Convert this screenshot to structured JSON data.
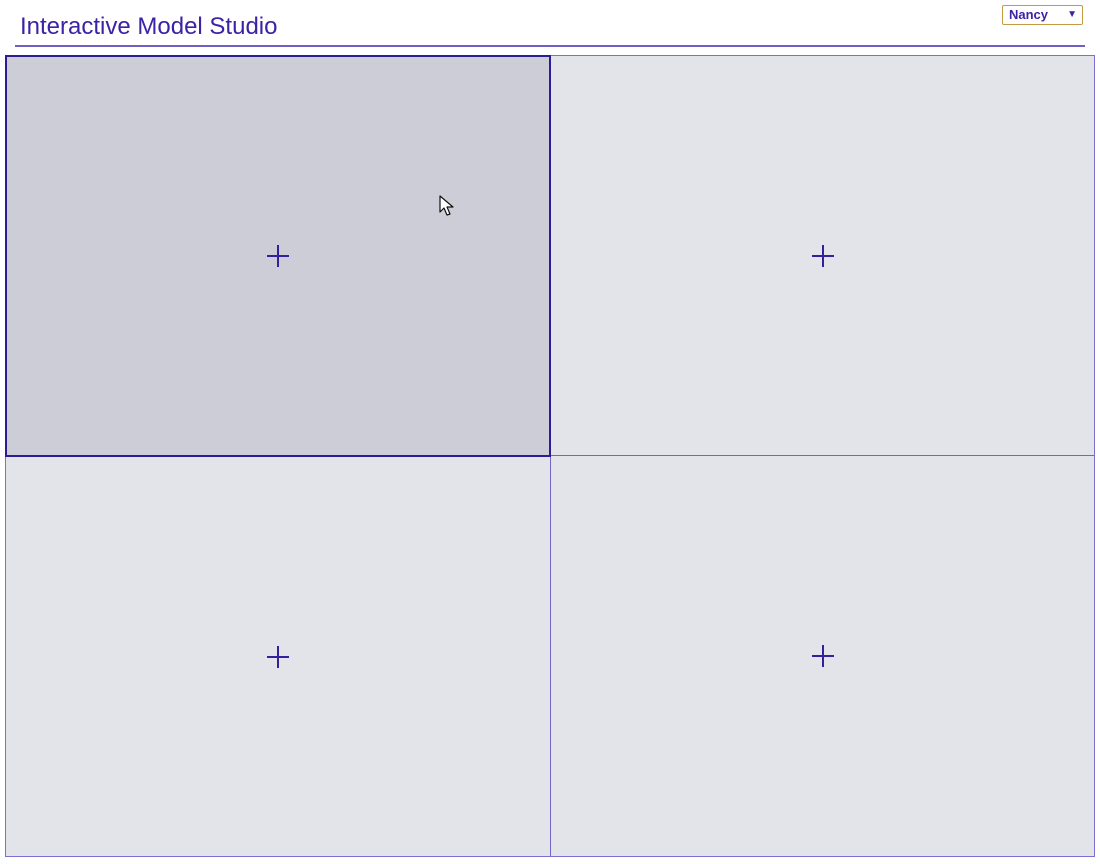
{
  "header": {
    "title": "Interactive Model Studio"
  },
  "user_menu": {
    "selected_user": "Nancy",
    "arrow_icon": "triangle-down-icon"
  },
  "panels": [
    {
      "name": "panel-top-left",
      "state": "active",
      "icon": "plus-icon"
    },
    {
      "name": "panel-top-right",
      "state": "empty",
      "icon": "plus-icon"
    },
    {
      "name": "panel-bottom-left",
      "state": "empty",
      "icon": "plus-icon"
    },
    {
      "name": "panel-bottom-right",
      "state": "empty",
      "icon": "plus-icon"
    }
  ],
  "pointer": {
    "icon": "mouse-pointer-icon"
  },
  "colors": {
    "accent": "#3b22a6",
    "rule": "#6f61c3",
    "panel_background": "#e3e3ea",
    "active_panel_background": "#cdcdd8",
    "select_border": "#c69a42"
  }
}
